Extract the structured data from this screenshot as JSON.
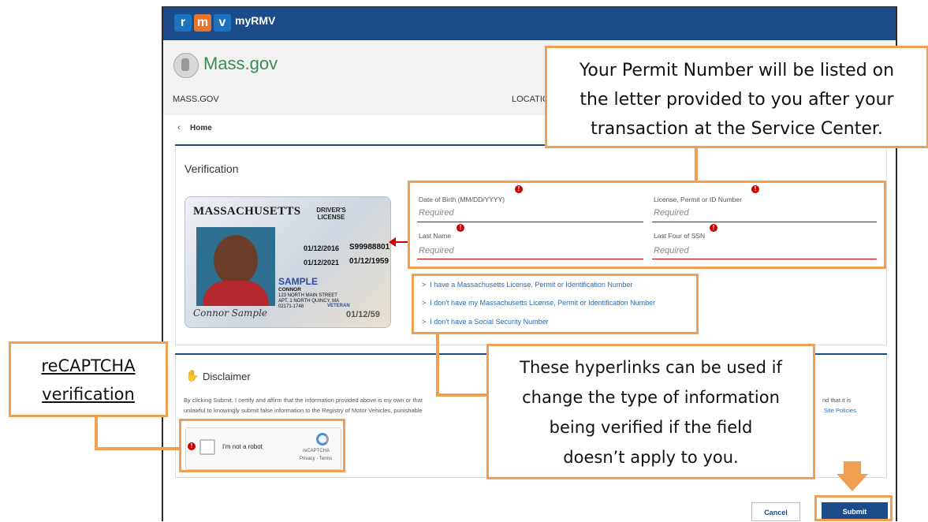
{
  "app": {
    "logo_letters": [
      "r",
      "m",
      "v"
    ],
    "logo_colors": [
      "#1e73be",
      "#e8742c",
      "#1e73be"
    ],
    "title": "myRMV"
  },
  "mass": {
    "brand": "Mass.gov",
    "nav_left": "MASS.GOV",
    "nav_right_partial": "LOCATIO",
    "crumb_home": "Home"
  },
  "verification": {
    "heading": "Verification",
    "card": {
      "state": "MASSACHUSETTS",
      "type": "DRIVER'S LICENSE",
      "number": "S99988801",
      "dob": "01/12/1959",
      "issued": "01/12/2016",
      "expires": "01/12/2021",
      "sample": "SAMPLE",
      "name": "CONNOR",
      "address": "123 NORTH MAIN STREET APT. 1 NORTH QUINCY, MA 02171-1748",
      "signature": "Connor Sample",
      "veteran": "VETERAN",
      "bottom_date": "01/12/59"
    },
    "fields": [
      {
        "label": "Date of Birth (MM/DD/YYYY)",
        "placeholder": "Required"
      },
      {
        "label": "License, Permit or ID Number",
        "placeholder": "Required"
      },
      {
        "label": "Last Name",
        "placeholder": "Required"
      },
      {
        "label": "Last Four of SSN",
        "placeholder": "Required"
      }
    ],
    "links": [
      "I have a Massachusetts License, Permit or Identification Number",
      "I don't have my Massachusetts License, Permit or Identification Number",
      "I don't have a Social Security Number"
    ]
  },
  "disclaimer": {
    "heading": "Disclaimer",
    "text_line1": "By clicking Submit, I certify and affirm that the information provided above is my own or that",
    "text_line2": "unlawful to knowingly submit false information to the Registry of Motor Vehicles, punishable",
    "text_right1": "nd that it is",
    "text_right2": "Site Policies."
  },
  "recaptcha": {
    "label": "I'm not a robot",
    "brand": "reCAPTCHA",
    "footer": "Privacy - Terms"
  },
  "buttons": {
    "cancel": "Cancel",
    "submit": "Submit"
  },
  "callouts": {
    "permit": [
      "Your Permit Number will be listed on",
      "the letter provided to you after your",
      "transaction at the Service Center."
    ],
    "hyperlinks": [
      "These hyperlinks can be used if",
      "change the type of information",
      "being verified if the field",
      "doesn’t apply to you."
    ],
    "recaptcha": [
      "reCAPTCHA",
      "verification"
    ]
  },
  "colors": {
    "rmv_blue": "#1c4b8a",
    "accent_orange": "#f0a050",
    "error_red": "#cc0000",
    "link_blue": "#2b6cb0",
    "mass_green": "#3c8a5a"
  }
}
